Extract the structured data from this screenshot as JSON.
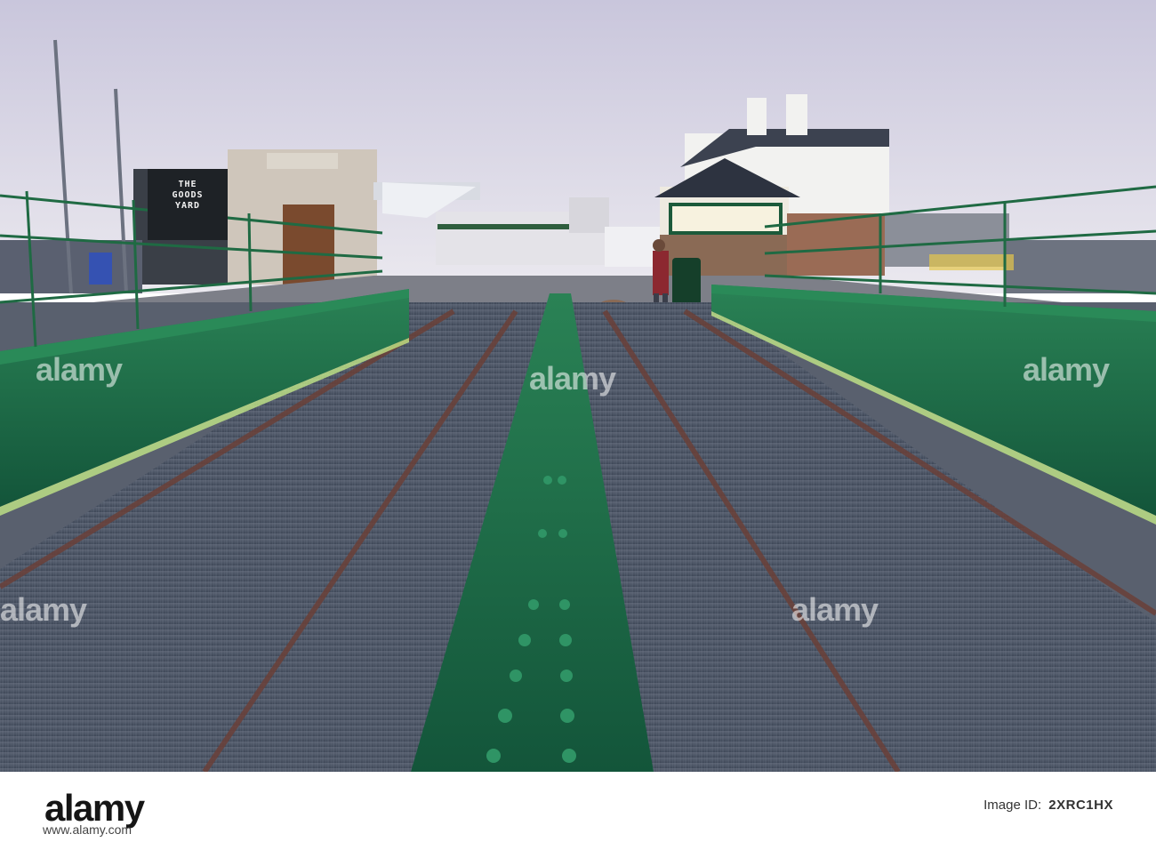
{
  "scene": {
    "sign_lines": [
      "THE",
      "GOODS",
      "YARD"
    ]
  },
  "watermarks": [
    "alamy",
    "alamy",
    "alamy",
    "alamy",
    "alamy"
  ],
  "footer": {
    "logo": "alamy",
    "image_id_label": "Image ID:",
    "image_id": "2XRC1HX",
    "url": "www.alamy.com"
  },
  "colors": {
    "sky_top": "#ccc9df",
    "sky_bottom": "#e9e9ef",
    "girder_green": "#1c6b40",
    "deck_grey": "#4c5566",
    "rail_brown": "#6a4038"
  }
}
